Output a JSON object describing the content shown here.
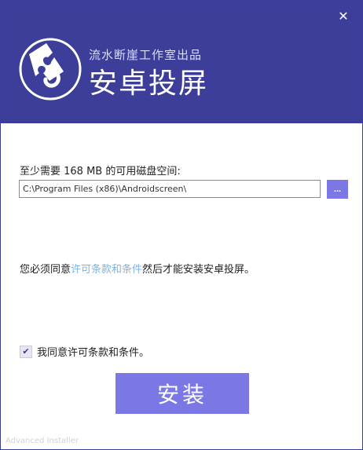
{
  "window": {
    "close_glyph": "✕",
    "close_icon": "close-icon"
  },
  "header": {
    "subtitle": "流水断崖工作室出品",
    "title": "安卓投屏",
    "logo_icon": "puzzle-logo-icon",
    "color": "#3d3d9a"
  },
  "install_dir": {
    "space_label": "至少需要 168 MB 的可用磁盘空间:",
    "path_value": "C:\\Program Files (x86)\\Androidscreen\\",
    "browse_label": "..."
  },
  "license": {
    "prefix": "您必须同意",
    "link_text": "许可条款和条件",
    "suffix": "然后才能安装安卓投屏。",
    "link_color": "#7ab4e8"
  },
  "agree": {
    "checked": true,
    "check_glyph": "✔",
    "label": "我同意许可条款和条件。"
  },
  "install_button": {
    "label": "安装",
    "color": "#7b78e6"
  },
  "footer": {
    "text": "Advanced Installer"
  }
}
